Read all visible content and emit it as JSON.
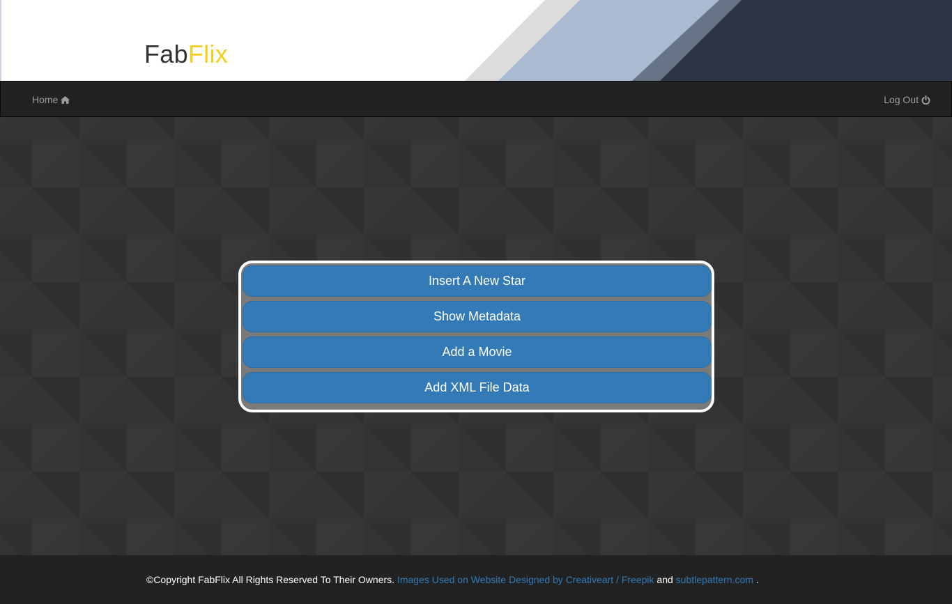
{
  "brand": {
    "part1": "Fab",
    "part2": "Flix",
    "part1_color": "#333333",
    "part2_color": "#f5cf1e"
  },
  "navbar": {
    "home_label": "Home",
    "home_icon": "home-icon",
    "logout_label": "Log Out",
    "logout_icon": "power-icon"
  },
  "menu": {
    "buttons": [
      {
        "label": "Insert A New Star"
      },
      {
        "label": "Show Metadata"
      },
      {
        "label": "Add a Movie"
      },
      {
        "label": "Add XML File Data"
      }
    ],
    "button_color": "#337ab7"
  },
  "footer": {
    "copyright": "©Copyright FabFlix All Rights Reserved To Their Owners.",
    "credit_link": "Images Used on Website Designed by Creativeart / Freepik",
    "and_text": "and",
    "pattern_link": "subtlepattern.com",
    "end_text": ".",
    "link_color": "#337ab7"
  }
}
